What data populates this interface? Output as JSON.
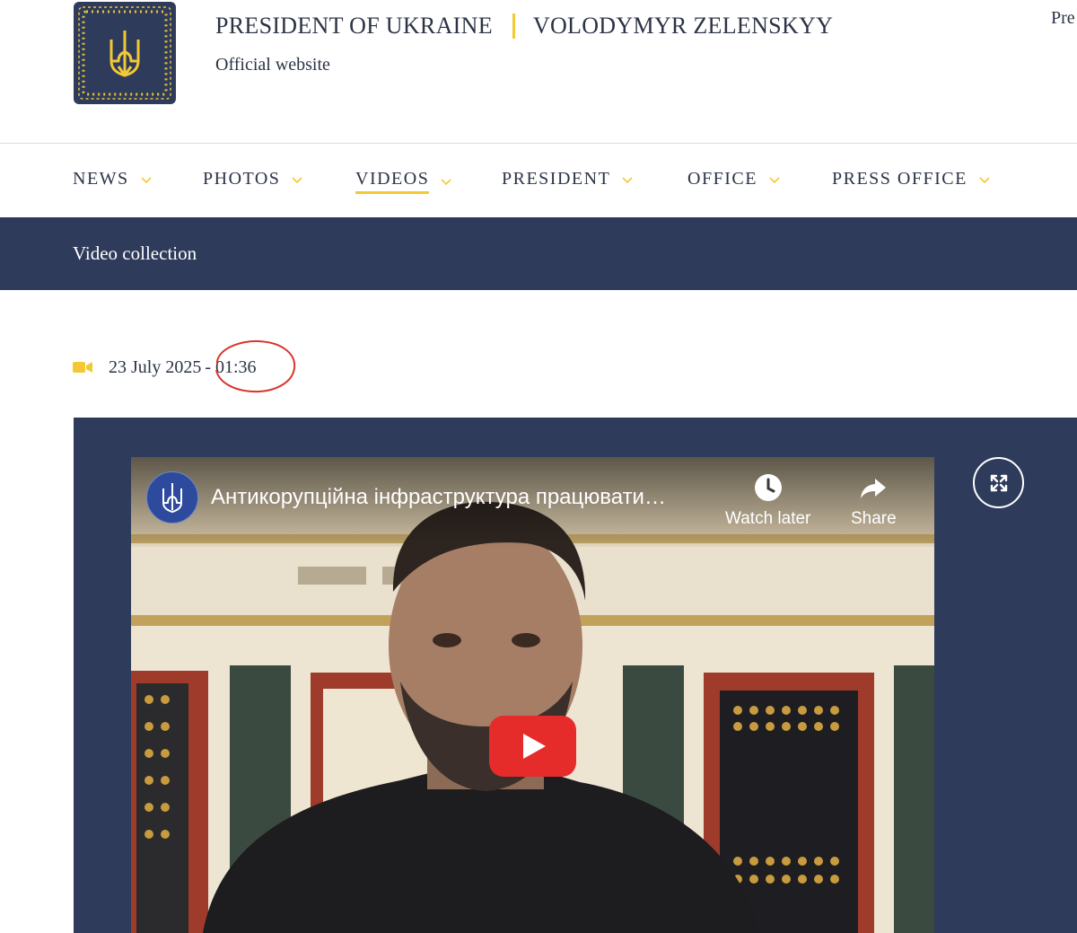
{
  "header": {
    "title_left": "PRESIDENT OF UKRAINE",
    "title_right": "VOLODYMYR ZELENSKYY",
    "subtitle": "Official website",
    "lang_link": "Pre"
  },
  "nav": {
    "items": [
      {
        "label": "NEWS",
        "active": false
      },
      {
        "label": "PHOTOS",
        "active": false
      },
      {
        "label": "VIDEOS",
        "active": true
      },
      {
        "label": "PRESIDENT",
        "active": false
      },
      {
        "label": "OFFICE",
        "active": false
      },
      {
        "label": "PRESS OFFICE",
        "active": false
      }
    ]
  },
  "section": {
    "title": "Video collection"
  },
  "meta": {
    "icon": "video-camera-icon",
    "date": "23 July 2025",
    "time": "- 01:36"
  },
  "video": {
    "title": "Антикорупційна інфраструктура працювати…",
    "watch_later_label": "Watch later",
    "share_label": "Share"
  },
  "colors": {
    "navy": "#2e3b5b",
    "accent_yellow": "#f2c935",
    "annotation_red": "#d9342b",
    "youtube_red": "#e62b2b"
  }
}
